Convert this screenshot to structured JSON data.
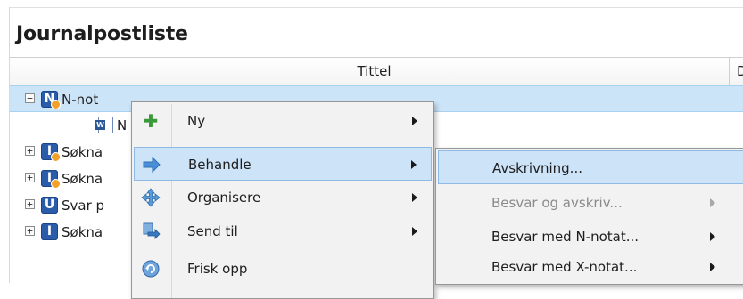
{
  "panel": {
    "title": "Journalpostliste"
  },
  "columns": {
    "title": "Tittel",
    "second": "Do"
  },
  "rows": [
    {
      "expander": "−",
      "badge": "N",
      "text": "N-not",
      "selected": true
    },
    {
      "expander": "",
      "icon": "word-document-icon",
      "text": "N"
    },
    {
      "expander": "+",
      "badge": "I",
      "text": "Søkna"
    },
    {
      "expander": "+",
      "badge": "I",
      "text": "Søkna"
    },
    {
      "expander": "+",
      "badge": "U",
      "text": "Svar p"
    },
    {
      "expander": "+",
      "badge": "I",
      "text": "Søkna"
    }
  ],
  "context_menu": {
    "items": [
      {
        "label": "Ny",
        "icon": "plus-icon",
        "submenu": true
      },
      {
        "label": "Behandle",
        "icon": "arrow-right-icon",
        "submenu": true,
        "highlighted": true
      },
      {
        "label": "Organisere",
        "icon": "move-arrows-icon",
        "submenu": true
      },
      {
        "label": "Send til",
        "icon": "send-to-icon",
        "submenu": true
      },
      {
        "label": "Frisk opp",
        "icon": "refresh-icon",
        "submenu": false
      }
    ]
  },
  "submenu": {
    "items": [
      {
        "label": "Avskrivning...",
        "submenu": false,
        "highlighted": true
      },
      {
        "label": "Besvar og avskriv...",
        "submenu": true,
        "disabled": true
      },
      {
        "label": "Besvar med N-notat...",
        "submenu": true
      },
      {
        "label": "Besvar med X-notat...",
        "submenu": true
      }
    ]
  },
  "colors": {
    "accent": "#2a5caa",
    "selection": "#cce4f7",
    "menu_highlight": "#cde3f8",
    "badge_dot": "#f2a12b"
  }
}
